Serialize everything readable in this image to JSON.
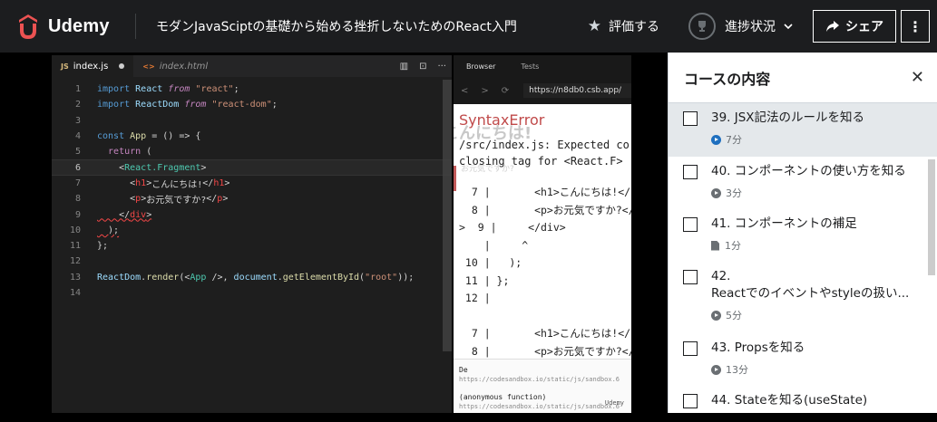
{
  "header": {
    "brand": "Udemy",
    "course_title": "モダンJavaSciptの基礎から始める挫折しないためのReact入門",
    "rate_label": "評価する",
    "progress_label": "進捗状況",
    "share_label": "シェア",
    "more_label": "⋮"
  },
  "editor": {
    "tabs": [
      {
        "label": "index.js",
        "icon": "JS"
      },
      {
        "label": "index.html",
        "icon": "<>"
      }
    ],
    "tools": [
      "▥",
      "⊡",
      "···"
    ],
    "line_numbers": [
      "1",
      "2",
      "3",
      "4",
      "5",
      "6",
      "7",
      "8",
      "9",
      "10",
      "11",
      "12",
      "13",
      "14"
    ],
    "code": {
      "l1": [
        "import",
        " ",
        "React",
        " ",
        "from",
        " ",
        "\"react\"",
        ";"
      ],
      "l2": [
        "import",
        " ",
        "ReactDom",
        " ",
        "from",
        " ",
        "\"react-dom\"",
        ";"
      ],
      "l4": [
        "const",
        " ",
        "App",
        " = () => {"
      ],
      "l5": [
        "  return",
        " ("
      ],
      "l6": [
        "    <",
        "React.Fragment",
        ">"
      ],
      "l7": [
        "      <",
        "h1",
        ">",
        "こんにちは!",
        "</",
        "h1",
        ">"
      ],
      "l8": [
        "      <",
        "p",
        ">",
        "お元気ですか?",
        "</",
        "p",
        ">"
      ],
      "l9": [
        "    </",
        "div",
        ">"
      ],
      "l10": [
        "  );"
      ],
      "l11": [
        "};"
      ],
      "l13": [
        "ReactDom",
        ".",
        "render",
        "(<",
        "App",
        " />, ",
        "document",
        ".",
        "getElementById",
        "(",
        "\"root\"",
        "));"
      ]
    }
  },
  "browser": {
    "tabs": [
      "Browser",
      "Tests"
    ],
    "nav": [
      "<",
      ">",
      "⟳"
    ],
    "url": "https://n8db0.csb.app/",
    "ghost_heading": "こんにちは!",
    "ghost_text": "お元気ですか?",
    "error_title": "SyntaxError",
    "error_message": "/src/index.js: Expected co\nclosing tag for <React.F>",
    "error_code": "  7 |       <h1>こんにちは!</\n  8 |       <p>お元気ですか?</\n>  9 |     </div>\n    |     ^\n 10 |   );\n 11 | };\n 12 |\n\n  7 |       <h1>こんにちは!</\n  8 |       <p>お元気ですか?</\n>  9 |     </div>",
    "footer_1": "De",
    "footer_1_url": "https://codesandbox.io/static/js/sandbox.6",
    "footer_2": "(anonymous function)",
    "footer_2_url": "https://codesandbox.io/static/js/sandbox.6",
    "watermark": "Udemy"
  },
  "sidebar": {
    "title": "コースの内容",
    "close": "✕",
    "items": [
      {
        "label": "39. JSX記法のルールを知る",
        "duration": "7分",
        "kind": "video",
        "active": true
      },
      {
        "label": "40. コンポーネントの使い方を知る",
        "duration": "3分",
        "kind": "video",
        "active": false
      },
      {
        "label": "41. コンポーネントの補足",
        "duration": "1分",
        "kind": "article",
        "active": false
      },
      {
        "label": "42.",
        "label_2": "Reactでのイベントやstyleの扱い...",
        "duration": "5分",
        "kind": "video",
        "active": false
      },
      {
        "label": "43. Propsを知る",
        "duration": "13分",
        "kind": "video",
        "active": false
      },
      {
        "label": "44. Stateを知る(useState)",
        "duration": "",
        "kind": "video",
        "active": false
      }
    ]
  },
  "colors": {
    "topbar": "#1c1d1f",
    "brand_red": "#ec5252",
    "active_item": "#e4e8eb",
    "error_red": "#c04a4a"
  }
}
